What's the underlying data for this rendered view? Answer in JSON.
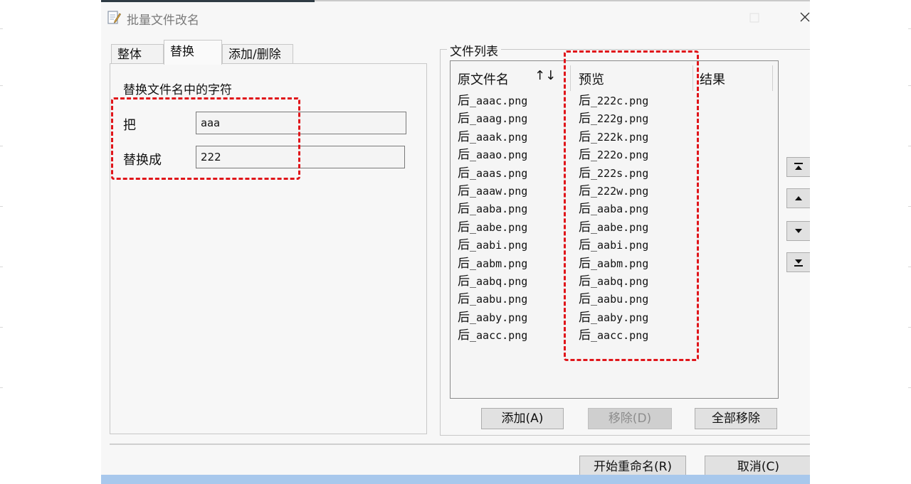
{
  "window": {
    "title": "批量文件改名",
    "icons": {
      "app": "notepad-pencil-icon",
      "minimize": "minimize-icon",
      "maximize": "maximize-icon",
      "close": "close-icon"
    }
  },
  "tabs": [
    {
      "label": "整体",
      "active": false
    },
    {
      "label": "替换",
      "active": true
    },
    {
      "label": "添加/删除",
      "active": false
    }
  ],
  "replace_panel": {
    "heading": "替换文件名中的字符",
    "from_label": "把",
    "from_value": "aaa",
    "to_label": "替换成",
    "to_value": "222"
  },
  "file_list": {
    "group_title": "文件列表",
    "columns": {
      "original": "原文件名",
      "sort_arrows": "↑↓",
      "preview": "预览",
      "result": "结果"
    },
    "rows": [
      {
        "original": "后_aaac.png",
        "preview": "后_222c.png"
      },
      {
        "original": "后_aaag.png",
        "preview": "后_222g.png"
      },
      {
        "original": "后_aaak.png",
        "preview": "后_222k.png"
      },
      {
        "original": "后_aaao.png",
        "preview": "后_222o.png"
      },
      {
        "original": "后_aaas.png",
        "preview": "后_222s.png"
      },
      {
        "original": "后_aaaw.png",
        "preview": "后_222w.png"
      },
      {
        "original": "后_aaba.png",
        "preview": "后_aaba.png"
      },
      {
        "original": "后_aabe.png",
        "preview": "后_aabe.png"
      },
      {
        "original": "后_aabi.png",
        "preview": "后_aabi.png"
      },
      {
        "original": "后_aabm.png",
        "preview": "后_aabm.png"
      },
      {
        "original": "后_aabq.png",
        "preview": "后_aabq.png"
      },
      {
        "original": "后_aabu.png",
        "preview": "后_aabu.png"
      },
      {
        "original": "后_aaby.png",
        "preview": "后_aaby.png"
      },
      {
        "original": "后_aacc.png",
        "preview": "后_aacc.png"
      }
    ],
    "buttons": {
      "add": "添加(A)",
      "remove": "移除(D)",
      "remove_all": "全部移除"
    },
    "order_icons": [
      "move-to-top-icon",
      "move-up-icon",
      "move-down-icon",
      "move-to-bottom-icon"
    ]
  },
  "footer": {
    "start": "开始重命名(R)",
    "cancel": "取消(C)"
  },
  "colors": {
    "highlight_dash": "#e0151a",
    "window_bg": "#f7f7f7",
    "button_bg": "#e1e1e1",
    "bottom_strip": "#a8c8ec"
  }
}
